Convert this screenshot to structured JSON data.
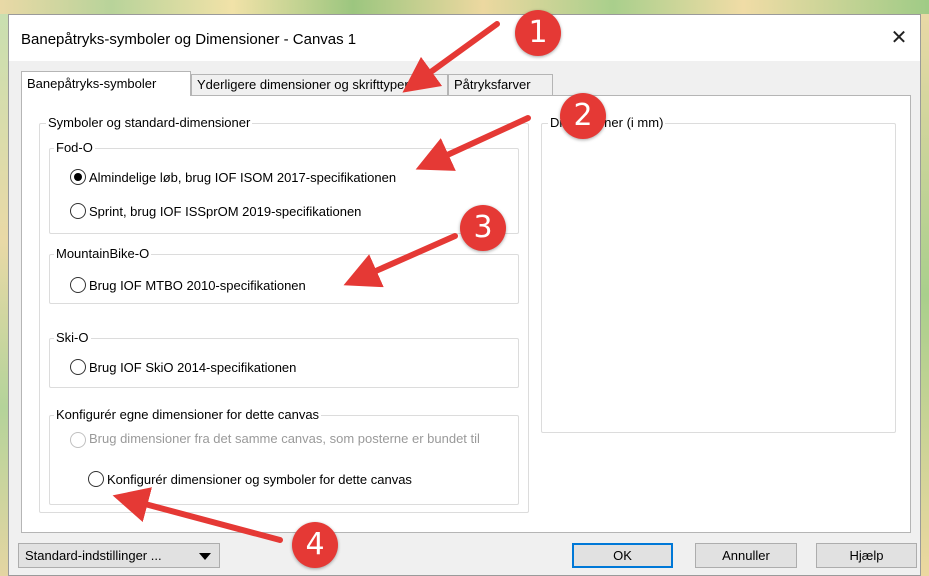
{
  "window": {
    "title": "Banepåtryks-symboler og Dimensioner - Canvas 1",
    "close_glyph": "✕"
  },
  "tabs": [
    {
      "label": "Banepåtryks-symboler",
      "active": true
    },
    {
      "label": "Yderligere dimensioner og skrifttyper",
      "active": false
    },
    {
      "label": "Påtryksfarver",
      "active": false
    }
  ],
  "symbols_group": {
    "label": "Symboler og standard-dimensioner",
    "foot_o": {
      "label": "Fod-O",
      "options": [
        {
          "label": "Almindelige løb, brug IOF ISOM 2017-specifikationen",
          "checked": true
        },
        {
          "label": "Sprint, brug IOF ISSprOM 2019-specifikationen",
          "checked": false
        }
      ]
    },
    "mtb_o": {
      "label": "MountainBike-O",
      "options": [
        {
          "label": "Brug IOF MTBO 2010-specifikationen",
          "checked": false
        }
      ]
    },
    "ski_o": {
      "label": "Ski-O",
      "options": [
        {
          "label": "Brug IOF SkiO 2014-specifikationen",
          "checked": false
        }
      ]
    },
    "custom": {
      "label": "Konfigurér egne dimensioner for dette canvas",
      "options": [
        {
          "label": "Brug dimensioner fra det samme canvas, som posterne er bundet til",
          "checked": false,
          "disabled": true
        },
        {
          "label": "Konfigurér dimensioner og symboler for dette canvas",
          "checked": false,
          "disabled": false
        }
      ]
    }
  },
  "dimensions_group": {
    "label": "Dimensioner (i mm)"
  },
  "footer": {
    "defaults_label": "Standard-indstillinger ...",
    "ok_label": "OK",
    "cancel_label": "Annuller",
    "help_label": "Hjælp"
  },
  "annotations": {
    "color": "#e53935",
    "badges": [
      "1",
      "2",
      "3",
      "4"
    ]
  }
}
